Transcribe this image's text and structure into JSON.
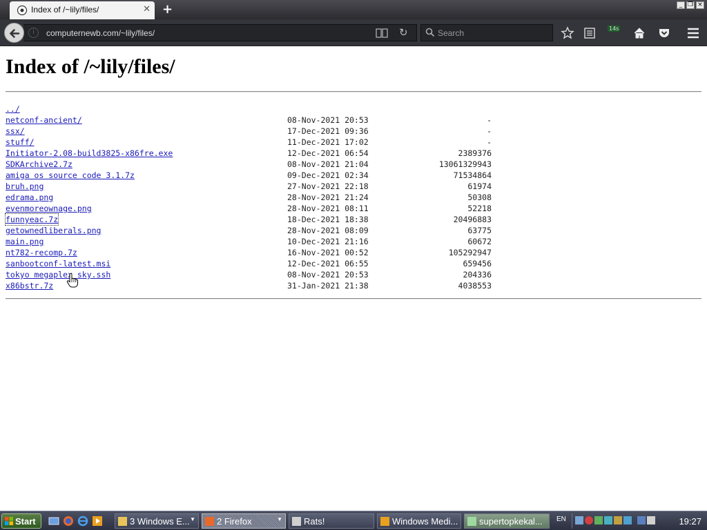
{
  "browser": {
    "tab_title": "Index of /~lily/files/",
    "url": "computernewb.com/~lily/files/",
    "search_placeholder": "Search",
    "extension_badge": "14s"
  },
  "page": {
    "heading": "Index of /~lily/files/",
    "parent_link": "../",
    "files": [
      {
        "name": "netconf-ancient/",
        "date": "08-Nov-2021 20:53",
        "size": "-"
      },
      {
        "name": "ssx/",
        "date": "17-Dec-2021 09:36",
        "size": "-"
      },
      {
        "name": "stuff/",
        "date": "11-Dec-2021 17:02",
        "size": "-"
      },
      {
        "name": "Initiator-2.08-build3825-x86fre.exe",
        "date": "12-Dec-2021 06:54",
        "size": "2389376"
      },
      {
        "name": "SDKArchive2.7z",
        "date": "08-Nov-2021 21:04",
        "size": "13061329943"
      },
      {
        "name": "amiga os source code 3.1.7z",
        "date": "09-Dec-2021 02:34",
        "size": "71534864"
      },
      {
        "name": "bruh.png",
        "date": "27-Nov-2021 22:18",
        "size": "61974"
      },
      {
        "name": "edrama.png",
        "date": "28-Nov-2021 21:24",
        "size": "50308"
      },
      {
        "name": "evenmoreownage.png",
        "date": "28-Nov-2021 08:11",
        "size": "52218"
      },
      {
        "name": "funnyeac.7z",
        "date": "18-Dec-2021 18:38",
        "size": "20496883"
      },
      {
        "name": "getownedliberals.png",
        "date": "28-Nov-2021 08:09",
        "size": "63775"
      },
      {
        "name": "main.png",
        "date": "10-Dec-2021 21:16",
        "size": "60672"
      },
      {
        "name": "nt782-recomp.7z",
        "date": "16-Nov-2021 00:52",
        "size": "105292947"
      },
      {
        "name": "sanbootconf-latest.msi",
        "date": "12-Dec-2021 06:55",
        "size": "659456"
      },
      {
        "name": "tokyo megaplex sky.ssh",
        "date": "08-Nov-2021 20:53",
        "size": "204336"
      },
      {
        "name": "x86bstr.7z",
        "date": "31-Jan-2021 21:38",
        "size": "4038553"
      }
    ]
  },
  "taskbar": {
    "start_label": "Start",
    "tasks": [
      {
        "label": "3 Windows E...",
        "icon": "folder-icon",
        "color": "#e8c55a"
      },
      {
        "label": "2 Firefox",
        "icon": "firefox-icon",
        "color": "#e8692a"
      },
      {
        "label": "Rats!",
        "icon": "app-icon",
        "color": "#cfcfcf"
      },
      {
        "label": "Windows Medi...",
        "icon": "media-player-icon",
        "color": "#e8a020"
      },
      {
        "label": "supertopkekal...",
        "icon": "notepad-icon",
        "color": "#9fd8a0"
      }
    ],
    "language": "EN",
    "clock": "19:27"
  }
}
